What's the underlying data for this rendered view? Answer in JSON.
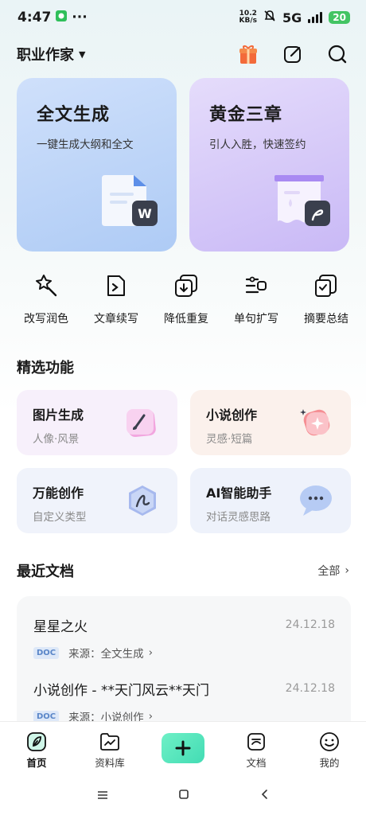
{
  "status_bar": {
    "time": "4:47",
    "more": "···",
    "speed_value": "10.2",
    "speed_unit": "KB/s",
    "network": "5G",
    "battery": "20"
  },
  "header": {
    "title": "职业作家"
  },
  "hero_cards": [
    {
      "title": "全文生成",
      "subtitle": "一键生成大纲和全文",
      "badge": "W"
    },
    {
      "title": "黄金三章",
      "subtitle": "引人入胜，快速签约"
    }
  ],
  "tools": [
    {
      "label": "改写润色",
      "icon": "magic-wand-icon"
    },
    {
      "label": "文章续写",
      "icon": "continue-doc-icon"
    },
    {
      "label": "降低重复",
      "icon": "reduce-duplicate-icon"
    },
    {
      "label": "单句扩写",
      "icon": "expand-sentence-icon"
    },
    {
      "label": "摘要总结",
      "icon": "summary-icon"
    }
  ],
  "featured": {
    "title": "精选功能",
    "items": [
      {
        "title": "图片生成",
        "subtitle": "人像·风景"
      },
      {
        "title": "小说创作",
        "subtitle": "灵感·短篇"
      },
      {
        "title": "万能创作",
        "subtitle": "自定义类型"
      },
      {
        "title": "AI智能助手",
        "subtitle": "对话灵感思路"
      }
    ]
  },
  "recent": {
    "title": "最近文档",
    "all_label": "全部",
    "docs": [
      {
        "title": "星星之火",
        "date": "24.12.18",
        "badge": "DOC",
        "source": "来源：全文生成"
      },
      {
        "title": "小说创作 - **天门风云**天门",
        "date": "24.12.18",
        "badge": "DOC",
        "source": "来源：小说创作"
      }
    ]
  },
  "bottom_nav": [
    {
      "label": "首页",
      "active": true
    },
    {
      "label": "资料库"
    },
    {
      "label": "文档"
    },
    {
      "label": "我的"
    }
  ],
  "colors": {
    "accent": "#4bdfb8",
    "hero_blue": "#b8d2f7",
    "hero_purple": "#d2c4f7",
    "gift": "#f36a3a"
  }
}
